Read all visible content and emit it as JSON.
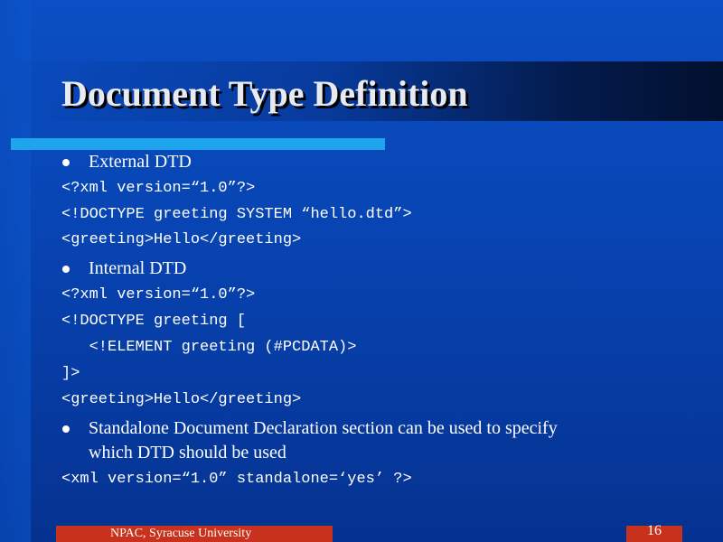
{
  "slide": {
    "title": "Document Type Definition",
    "bullets": [
      "External DTD",
      "Internal DTD",
      "Standalone Document Declaration section can be used to specify",
      "which DTD should be used"
    ],
    "external_code": [
      "<?xml version=“1.0”?>",
      "<!DOCTYPE greeting SYSTEM “hello.dtd”>",
      "<greeting>Hello</greeting>"
    ],
    "internal_code": [
      "<?xml version=“1.0”?>",
      "<!DOCTYPE greeting [",
      "   <!ELEMENT greeting (#PCDATA)>",
      "]>",
      "<greeting>Hello</greeting>"
    ],
    "standalone_code": "<xml version=“1.0” standalone=‘yes’ ?>"
  },
  "footer": {
    "org": "NPAC, Syracuse University",
    "page_number": "16"
  },
  "colors": {
    "background": "#0845b4",
    "accent_bar": "#1ea5ee",
    "footer": "#c8321c"
  }
}
